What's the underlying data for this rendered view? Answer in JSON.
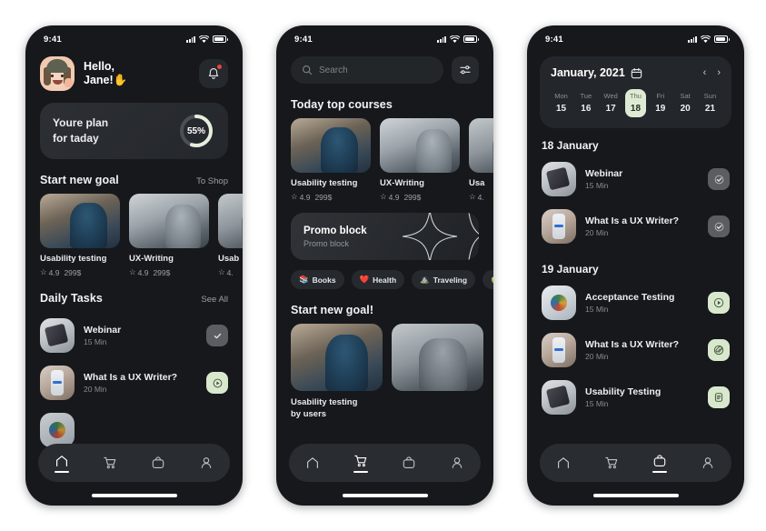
{
  "meta": {
    "status_time": "9:41",
    "accent_green": "#d8e8cd",
    "accent_red": "#e8453c",
    "screen_bg": "#16181c",
    "card_bg": "#23262a"
  },
  "phone1": {
    "greeting_line1": "Hello,",
    "greeting_line2": "Jane!",
    "greeting_emoji": "✋",
    "bell_icon": "bell-icon",
    "plan": {
      "line1": "Youre plan",
      "line2": "for taday",
      "percent": 55,
      "percent_label": "55%"
    },
    "goal_section": {
      "title": "Start new goal",
      "link": "To Shop",
      "courses": [
        {
          "title": "Usability testing",
          "rating": "4.9",
          "price": "299$"
        },
        {
          "title": "UX-Writing",
          "rating": "4.9",
          "price": "299$"
        },
        {
          "title": "Usab",
          "rating": "4.",
          "price": ""
        }
      ]
    },
    "tasks_section": {
      "title": "Daily Tasks",
      "link": "See All",
      "tasks": [
        {
          "title": "Webinar",
          "duration": "15 Min",
          "action": "check-icon"
        },
        {
          "title": "What Is a UX Writer?",
          "duration": "20 Min",
          "action": "play-icon"
        }
      ]
    },
    "nav": [
      {
        "name": "home",
        "icon": "home-icon",
        "active": true
      },
      {
        "name": "cart",
        "icon": "cart-icon",
        "active": false
      },
      {
        "name": "bag",
        "icon": "bag-icon",
        "active": false
      },
      {
        "name": "profile",
        "icon": "person-icon",
        "active": false
      }
    ]
  },
  "phone2": {
    "search_placeholder": "Search",
    "filter_icon": "sliders-icon",
    "top_section": {
      "title": "Today top courses",
      "courses": [
        {
          "title": "Usability testing",
          "rating": "4.9",
          "price": "299$"
        },
        {
          "title": "UX-Writing",
          "rating": "4.9",
          "price": "299$"
        },
        {
          "title": "Usa",
          "rating": "4.",
          "price": ""
        }
      ]
    },
    "promo": {
      "title": "Promo block",
      "subtitle": "Promo block"
    },
    "chips": [
      {
        "label": "Books",
        "emoji": "📚"
      },
      {
        "label": "Health",
        "emoji": "❤️"
      },
      {
        "label": "Traveling",
        "emoji": "⛰️"
      },
      {
        "label": "",
        "emoji": "🍏"
      }
    ],
    "goal_section": {
      "title": "Start new goal!",
      "cards": [
        {
          "title": "Usability testing\nby users"
        },
        {
          "title": ""
        }
      ]
    },
    "nav": [
      {
        "name": "home",
        "icon": "home-icon",
        "active": false
      },
      {
        "name": "cart",
        "icon": "cart-icon",
        "active": true
      },
      {
        "name": "bag",
        "icon": "bag-icon",
        "active": false
      },
      {
        "name": "profile",
        "icon": "person-icon",
        "active": false
      }
    ]
  },
  "phone3": {
    "calendar": {
      "month_year": "January, 2021",
      "calendar_icon": "calendar-icon",
      "prev": "‹",
      "next": "›",
      "days": [
        {
          "dow": "Mon",
          "num": "15",
          "active": false
        },
        {
          "dow": "Tue",
          "num": "16",
          "active": false
        },
        {
          "dow": "Wed",
          "num": "17",
          "active": false
        },
        {
          "dow": "Thu",
          "num": "18",
          "active": true
        },
        {
          "dow": "Fri",
          "num": "19",
          "active": false
        },
        {
          "dow": "Sat",
          "num": "20",
          "active": false
        },
        {
          "dow": "Sun",
          "num": "21",
          "active": false
        }
      ]
    },
    "groups": [
      {
        "heading": "18 January",
        "tasks": [
          {
            "title": "Webinar",
            "duration": "15 Min",
            "action": "check-icon"
          },
          {
            "title": "What Is a UX Writer?",
            "duration": "20 Min",
            "action": "check-icon"
          }
        ]
      },
      {
        "heading": "19 January",
        "tasks": [
          {
            "title": "Acceptance Testing",
            "duration": "15 Min",
            "action": "play-icon"
          },
          {
            "title": "What Is a UX Writer?",
            "duration": "20 Min",
            "action": "paperclip-icon"
          },
          {
            "title": "Usability Testing",
            "duration": "15 Min",
            "action": "document-icon"
          }
        ]
      }
    ],
    "nav": [
      {
        "name": "home",
        "icon": "home-icon",
        "active": false
      },
      {
        "name": "cart",
        "icon": "cart-icon",
        "active": false
      },
      {
        "name": "bag",
        "icon": "bag-icon",
        "active": true
      },
      {
        "name": "profile",
        "icon": "person-icon",
        "active": false
      }
    ]
  }
}
